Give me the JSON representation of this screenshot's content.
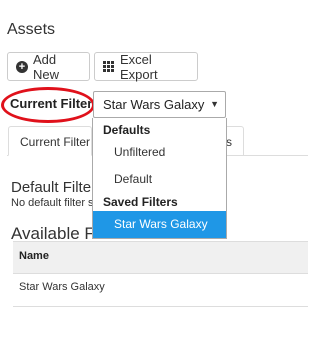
{
  "page": {
    "title": "Assets"
  },
  "toolbar": {
    "add_new_label": "Add New",
    "excel_export_label": "Excel Export",
    "add_icon": "plus-circle-icon",
    "export_icon": "grid-icon"
  },
  "filter": {
    "label": "Current Filter:",
    "selected": "Star Wars Galaxy",
    "highlight_color": "#e0111b",
    "dropdown": {
      "groups": [
        {
          "label": "Defaults",
          "options": [
            "Unfiltered",
            "Default"
          ]
        },
        {
          "label": "Saved Filters",
          "options": [
            "Star Wars Galaxy"
          ]
        }
      ],
      "selected_color": "#1f97e6"
    }
  },
  "tabs": [
    {
      "label": "Current Filter"
    },
    {
      "label": "s"
    }
  ],
  "default_filter": {
    "heading": "Default Filte",
    "message": "No default filter s"
  },
  "available_filters": {
    "heading": "Available Fi",
    "table": {
      "columns": [
        "Name"
      ],
      "rows": [
        [
          "Star Wars Galaxy"
        ]
      ]
    }
  }
}
